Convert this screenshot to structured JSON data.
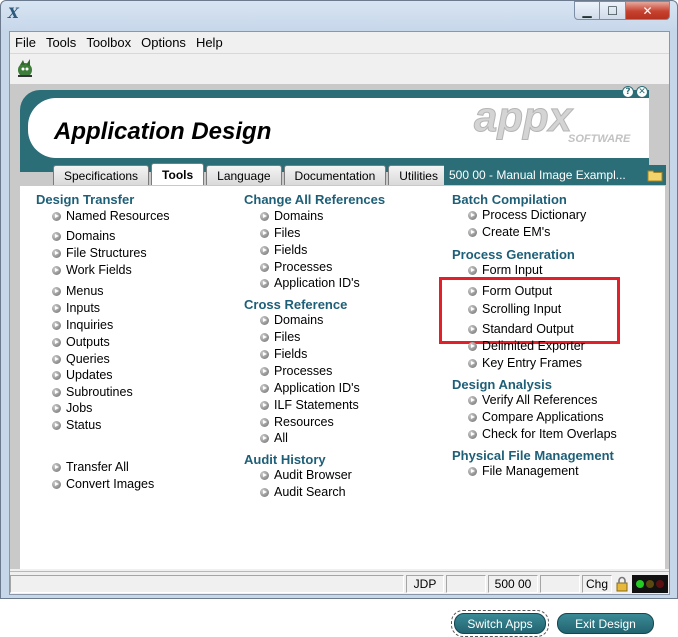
{
  "menu": [
    "File",
    "Tools",
    "Toolbox",
    "Options",
    "Help"
  ],
  "header": {
    "title": "Application Design",
    "logo_text": "appx",
    "logo_sub": "SOFTWARE"
  },
  "tabs": [
    "Specifications",
    "Tools",
    "Language",
    "Documentation",
    "Utilities"
  ],
  "active_tab": "Tools",
  "app_field": "500 00 - Manual Image Exampl...",
  "design_transfer": {
    "heading": "Design Transfer",
    "items": [
      "Named Resources",
      "Domains",
      "File Structures",
      "Work Fields",
      "Menus",
      "Inputs",
      "Inquiries",
      "Outputs",
      "Queries",
      "Updates",
      "Subroutines",
      "Jobs",
      "Status",
      "Transfer All",
      "Convert Images"
    ]
  },
  "change_all_references": {
    "heading": "Change All References",
    "items": [
      "Domains",
      "Files",
      "Fields",
      "Processes",
      "Application ID's"
    ]
  },
  "cross_reference": {
    "heading": "Cross Reference",
    "items": [
      "Domains",
      "Files",
      "Fields",
      "Processes",
      "Application ID's",
      "ILF Statements",
      "Resources",
      "All"
    ]
  },
  "audit_history": {
    "heading": "Audit History",
    "items": [
      "Audit Browser",
      "Audit Search"
    ]
  },
  "batch_compilation": {
    "heading": "Batch Compilation",
    "items": [
      "Process Dictionary",
      "Create EM's"
    ]
  },
  "process_generation": {
    "heading": "Process Generation",
    "items": [
      "Form Input",
      "Form Output",
      "Scrolling Input",
      "Standard Output",
      "Delimited Exporter",
      "Key Entry Frames"
    ]
  },
  "design_analysis": {
    "heading": "Design Analysis",
    "items": [
      "Verify All References",
      "Compare Applications",
      "Check for Item Overlaps"
    ]
  },
  "physical_file_management": {
    "heading": "Physical File Management",
    "items": [
      "File Management"
    ]
  },
  "buttons": {
    "switch_apps": "Switch Apps",
    "exit_design": "Exit Design"
  },
  "status": {
    "user": "JDP",
    "app": "500 00",
    "mode": "Chg"
  },
  "colors": {
    "teal": "#2b6e78",
    "heading": "#1e5f78",
    "highlight": "#e2202a"
  }
}
